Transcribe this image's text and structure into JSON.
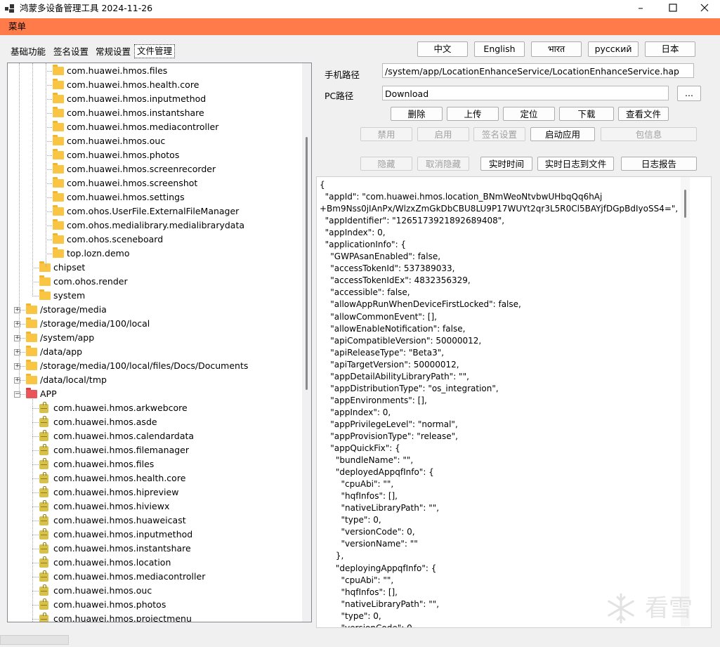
{
  "window": {
    "title": "鸿蒙多设备管理工具 2024-11-26",
    "controls": [
      "minimize",
      "maximize",
      "close"
    ]
  },
  "menubar": {
    "item": "菜单",
    "accent_color": "#ff7c4a"
  },
  "tabs": [
    {
      "label": "基础功能",
      "active": false
    },
    {
      "label": "签名设置",
      "active": false
    },
    {
      "label": "常规设置",
      "active": false
    },
    {
      "label": "文件管理",
      "active": true
    }
  ],
  "languages": [
    "中文",
    "English",
    "भारत",
    "русский",
    "日本"
  ],
  "tree": {
    "rows": [
      {
        "label": "com.huawei.hmos.files",
        "icon": "folder",
        "depth": 3
      },
      {
        "label": "com.huawei.hmos.health.core",
        "icon": "folder",
        "depth": 3
      },
      {
        "label": "com.huawei.hmos.inputmethod",
        "icon": "folder",
        "depth": 3
      },
      {
        "label": "com.huawei.hmos.instantshare",
        "icon": "folder",
        "depth": 3
      },
      {
        "label": "com.huawei.hmos.mediacontroller",
        "icon": "folder",
        "depth": 3
      },
      {
        "label": "com.huawei.hmos.ouc",
        "icon": "folder",
        "depth": 3
      },
      {
        "label": "com.huawei.hmos.photos",
        "icon": "folder",
        "depth": 3
      },
      {
        "label": "com.huawei.hmos.screenrecorder",
        "icon": "folder",
        "depth": 3
      },
      {
        "label": "com.huawei.hmos.screenshot",
        "icon": "folder",
        "depth": 3
      },
      {
        "label": "com.huawei.hmos.settings",
        "icon": "folder",
        "depth": 3
      },
      {
        "label": "com.ohos.UserFile.ExternalFileManager",
        "icon": "folder",
        "depth": 3
      },
      {
        "label": "com.ohos.medialibrary.medialibrarydata",
        "icon": "folder",
        "depth": 3
      },
      {
        "label": "com.ohos.sceneboard",
        "icon": "folder",
        "depth": 3
      },
      {
        "label": "top.lozn.demo",
        "icon": "folder",
        "depth": 3
      },
      {
        "label": "chipset",
        "icon": "folder",
        "depth": 2
      },
      {
        "label": "com.ohos.render",
        "icon": "folder",
        "depth": 2
      },
      {
        "label": "system",
        "icon": "folder",
        "depth": 2
      },
      {
        "label": "/storage/media",
        "icon": "folder",
        "depth": 1,
        "expander": "+"
      },
      {
        "label": "/storage/media/100/local",
        "icon": "folder",
        "depth": 1,
        "expander": "+"
      },
      {
        "label": "/system/app",
        "icon": "folder",
        "depth": 1,
        "expander": "+"
      },
      {
        "label": "/data/app",
        "icon": "folder",
        "depth": 1,
        "expander": "+"
      },
      {
        "label": "/storage/media/100/local/files/Docs/Documents",
        "icon": "folder",
        "depth": 1,
        "expander": "+"
      },
      {
        "label": "/data/local/tmp",
        "icon": "folder",
        "depth": 1,
        "expander": "+"
      },
      {
        "label": "APP",
        "icon": "red-folder",
        "depth": 1,
        "expander": "−"
      },
      {
        "label": "com.huawei.hmos.arkwebcore",
        "icon": "package",
        "depth": 2
      },
      {
        "label": "com.huawei.hmos.asde",
        "icon": "package",
        "depth": 2
      },
      {
        "label": "com.huawei.hmos.calendardata",
        "icon": "package",
        "depth": 2
      },
      {
        "label": "com.huawei.hmos.filemanager",
        "icon": "package",
        "depth": 2
      },
      {
        "label": "com.huawei.hmos.files",
        "icon": "package",
        "depth": 2
      },
      {
        "label": "com.huawei.hmos.health.core",
        "icon": "package",
        "depth": 2
      },
      {
        "label": "com.huawei.hmos.hipreview",
        "icon": "package",
        "depth": 2
      },
      {
        "label": "com.huawei.hmos.hiviewx",
        "icon": "package",
        "depth": 2
      },
      {
        "label": "com.huawei.hmos.huaweicast",
        "icon": "package",
        "depth": 2
      },
      {
        "label": "com.huawei.hmos.inputmethod",
        "icon": "package",
        "depth": 2
      },
      {
        "label": "com.huawei.hmos.instantshare",
        "icon": "package",
        "depth": 2
      },
      {
        "label": "com.huawei.hmos.location",
        "icon": "package",
        "depth": 2
      },
      {
        "label": "com.huawei.hmos.mediacontroller",
        "icon": "package",
        "depth": 2
      },
      {
        "label": "com.huawei.hmos.ouc",
        "icon": "package",
        "depth": 2
      },
      {
        "label": "com.huawei.hmos.photos",
        "icon": "package",
        "depth": 2
      },
      {
        "label": "com.huawei.hmos.projectmenu",
        "icon": "package",
        "depth": 2
      }
    ]
  },
  "paths": {
    "phone_label": "手机路径",
    "phone_value": "/system/app/LocationEnhanceService/LocationEnhanceService.hap",
    "pc_label": "PC路径",
    "pc_value": "Download",
    "browse_label": "..."
  },
  "actions": {
    "row1": [
      {
        "label": "删除",
        "enabled": true
      },
      {
        "label": "上传",
        "enabled": true
      },
      {
        "label": "定位",
        "enabled": true
      },
      {
        "label": "下载",
        "enabled": true
      },
      {
        "label": "查看文件",
        "enabled": true
      }
    ],
    "row2": [
      {
        "label": "禁用",
        "enabled": false
      },
      {
        "label": "启用",
        "enabled": false
      },
      {
        "label": "签名设置",
        "enabled": false
      },
      {
        "label": "启动应用",
        "enabled": true
      },
      {
        "label": "包信息",
        "enabled": false
      }
    ],
    "row3": [
      {
        "label": "隐藏",
        "enabled": false
      },
      {
        "label": "取消隐藏",
        "enabled": false
      },
      {
        "label": "实时时间",
        "enabled": true
      },
      {
        "label": "实时日志到文件",
        "enabled": true
      },
      {
        "label": "日志报告",
        "enabled": true
      }
    ]
  },
  "json_output": "{\n  \"appId\": \"com.huawei.hmos.location_BNmWeoNtvbwUHbqQq6hAj\n+Bm9Nss0jIAnPx/WlzxZmGkDbCBU8LU9P17WUYt2qr3L5R0Cl5BAYjfDGpBdIyoSS4=\",\n  \"appIdentifier\": \"1265173921892689408\",\n  \"appIndex\": 0,\n  \"applicationInfo\": {\n    \"GWPAsanEnabled\": false,\n    \"accessTokenId\": 537389033,\n    \"accessTokenIdEx\": 4832356329,\n    \"accessible\": false,\n    \"allowAppRunWhenDeviceFirstLocked\": false,\n    \"allowCommonEvent\": [],\n    \"allowEnableNotification\": false,\n    \"apiCompatibleVersion\": 50000012,\n    \"apiReleaseType\": \"Beta3\",\n    \"apiTargetVersion\": 50000012,\n    \"appDetailAbilityLibraryPath\": \"\",\n    \"appDistributionType\": \"os_integration\",\n    \"appEnvironments\": [],\n    \"appIndex\": 0,\n    \"appPrivilegeLevel\": \"normal\",\n    \"appProvisionType\": \"release\",\n    \"appQuickFix\": {\n      \"bundleName\": \"\",\n      \"deployedAppqfInfo\": {\n        \"cpuAbi\": \"\",\n        \"hqfInfos\": [],\n        \"nativeLibraryPath\": \"\",\n        \"type\": 0,\n        \"versionCode\": 0,\n        \"versionName\": \"\"\n      },\n      \"deployingAppqfInfo\": {\n        \"cpuAbi\": \"\",\n        \"hqfInfos\": [],\n        \"nativeLibraryPath\": \"\",\n        \"type\": 0,\n        \"versionCode\": 0",
  "watermark": {
    "text": "看雪",
    "icon": "snowflake-logo"
  }
}
